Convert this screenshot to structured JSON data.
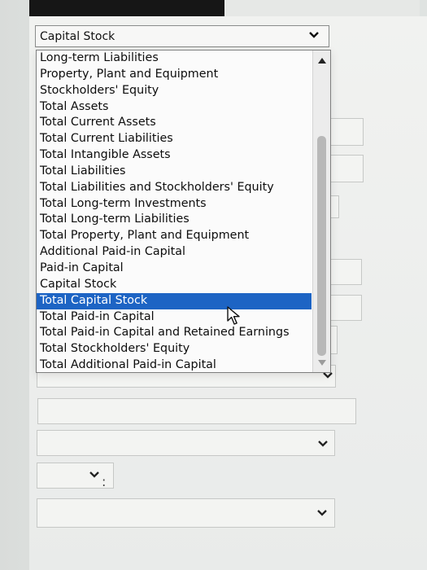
{
  "form": {
    "selected_account": "Capital Stock",
    "dropdown_options": [
      "Long-term Liabilities",
      "Property, Plant and Equipment",
      "Stockholders' Equity",
      "Total Assets",
      "Total Current Assets",
      "Total Current Liabilities",
      "Total Intangible Assets",
      "Total Liabilities",
      "Total Liabilities and Stockholders' Equity",
      "Total Long-term Investments",
      "Total Long-term Liabilities",
      "Total Property, Plant and Equipment",
      "Additional Paid-in Capital",
      "Paid-in Capital",
      "Capital Stock",
      "Total Capital Stock",
      "Total Paid-in Capital",
      "Total Paid-in Capital and Retained Earnings",
      "Total Stockholders' Equity",
      "Total Additional Paid-in Capital"
    ],
    "highlighted_option": "Total Capital Stock",
    "colon_text": ":"
  },
  "icons": {
    "select_chevron": "chevron-down-icon",
    "scroll_up": "triangle-up-icon",
    "scroll_down": "triangle-down-icon",
    "pointer": "mouse-pointer-icon"
  },
  "colors": {
    "selection_highlight": "#1d64c4",
    "text": "#111111",
    "border": "#8a8c8b"
  }
}
